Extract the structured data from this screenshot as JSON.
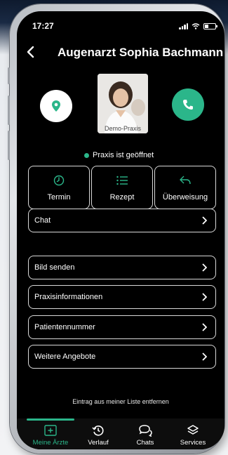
{
  "status_bar": {
    "time": "17:27"
  },
  "header": {
    "title": "Augenarzt Sophia Bachmann"
  },
  "profile": {
    "photo_caption": "Demo-Praxis",
    "status_text": "Praxis ist geöffnet",
    "status_color": "#2bb68a"
  },
  "quick_actions": [
    {
      "label": "Termin",
      "icon": "clock-icon"
    },
    {
      "label": "Rezept",
      "icon": "list-icon"
    },
    {
      "label": "Überweisung",
      "icon": "forward-arrow-icon"
    }
  ],
  "rows": {
    "chat": "Chat",
    "bild_senden": "Bild senden",
    "praxisinformationen": "Praxisinformationen",
    "patientennummer": "Patientennummer",
    "weitere_angebote": "Weitere Angebote"
  },
  "remove_link": "Eintrag aus meiner Liste entfernen",
  "tabs": [
    {
      "label": "Meine Ärzte",
      "icon": "add-square-icon",
      "active": true
    },
    {
      "label": "Verlauf",
      "icon": "history-icon",
      "active": false
    },
    {
      "label": "Chats",
      "icon": "chat-bubbles-icon",
      "active": false
    },
    {
      "label": "Services",
      "icon": "layers-icon",
      "active": false
    }
  ],
  "colors": {
    "accent": "#2bb68a",
    "background": "#000000",
    "border": "#d8d8d8"
  }
}
